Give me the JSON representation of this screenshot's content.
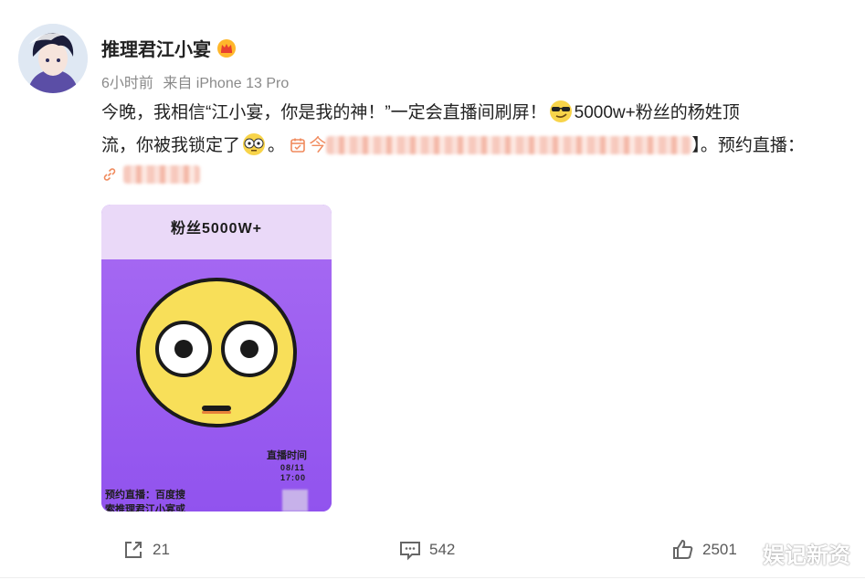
{
  "post": {
    "username": "推理君江小宴",
    "time": "6小时前",
    "source": "来自 iPhone 13 Pro",
    "content": {
      "line1_a": "今晚，我相信“江小宴，你是我的神！”一定会直播间刷屏！",
      "line1_b": "5000w+粉丝的杨姓顶",
      "line2_a": "流，你被我锁定了",
      "line2_b": "。",
      "event_prefix": "今",
      "line2_c": "】。预约直播：",
      "emoji_1": "sunglasses-smirk-emoji",
      "emoji_2": "wide-eyes-emoji"
    },
    "card": {
      "title": "粉丝5000W+",
      "live_label": "直播时间",
      "live_date": "08/11",
      "live_time": "17:00",
      "reserve_line1": "预约直播：百度搜",
      "reserve_line2": "索推理君江小宴或"
    }
  },
  "actions": {
    "repost_count": "21",
    "comment_count": "542",
    "like_count": "2501"
  },
  "watermark": "娱记新资",
  "colors": {
    "card_purple": "#9b5cf0",
    "card_header": "#ead9f8",
    "face_yellow": "#f8df59",
    "link_orange": "#f08a5d"
  }
}
